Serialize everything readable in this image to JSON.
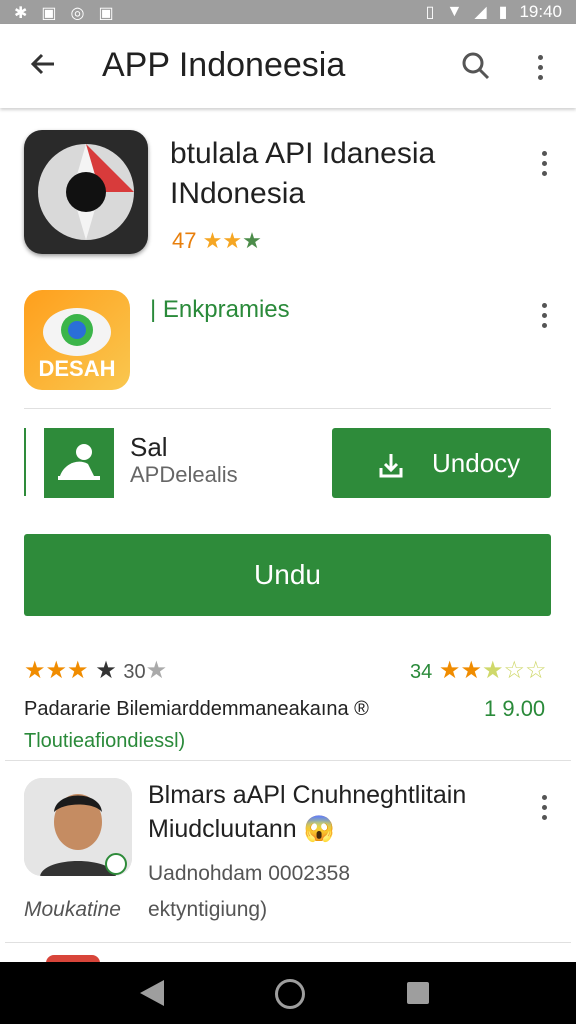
{
  "statusbar": {
    "time": "19:40"
  },
  "toolbar": {
    "title": "APP Indoneesia",
    "back_icon": "arrow-left-icon",
    "search_icon": "search-icon",
    "more_icon": "more-vert-icon"
  },
  "app1": {
    "title_line1": "btulala API Idanesia",
    "title_line2": "INdonesia",
    "rating_text": "47"
  },
  "app2": {
    "label": "| Enkpramies",
    "icon_text": "DESAH"
  },
  "app3": {
    "name": "Sal",
    "developer": "APDelealis",
    "button_label": "Undocy"
  },
  "install_button": {
    "label": "Undu"
  },
  "ratings": {
    "left_count": "30",
    "right_count": "34",
    "description": "Padararie Bilemiarddemmaneakaına ®",
    "price": "1 9.00",
    "sub": "Tloutieafiondiessl)"
  },
  "review": {
    "title_line1": "Blmars aAPl Cnuhneghtlitain",
    "title_line2": "Miudcluutann 😱",
    "sub": "Uadnohdam 0002358",
    "foot_left": "Moukatine",
    "foot_right": "ektyntigiung)"
  },
  "colors": {
    "accent_green": "#2e8b3a",
    "star_orange": "#f08c00",
    "statusbar": "#9e9e9e"
  }
}
